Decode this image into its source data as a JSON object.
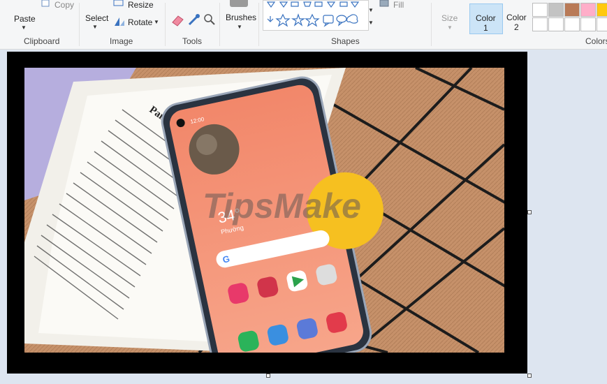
{
  "ribbon": {
    "clipboard": {
      "paste_label": "Paste",
      "copy_label": "Copy",
      "group_label": "Clipboard"
    },
    "image": {
      "select_label": "Select",
      "resize_label": "Resize",
      "rotate_label": "Rotate",
      "group_label": "Image"
    },
    "tools": {
      "group_label": "Tools"
    },
    "brushes": {
      "label": "Brushes"
    },
    "shapes": {
      "group_label": "Shapes",
      "fill_label": "Fill"
    },
    "size": {
      "label": "Size"
    },
    "color1": {
      "label_line1": "Color",
      "label_line2": "1"
    },
    "color2": {
      "label_line1": "Color",
      "label_line2": "2"
    },
    "colors": {
      "group_label": "Colors"
    }
  },
  "palette_colors": [
    "#ffffff",
    "#c3c3c3",
    "#b97a57",
    "#ffaec9",
    "#ffc90e"
  ],
  "canvas_image": {
    "phone_time": "12:00",
    "phone_temp": "34°",
    "phone_location": "Phường",
    "watermark": "TipsMake",
    "book_title": "Pangko"
  }
}
